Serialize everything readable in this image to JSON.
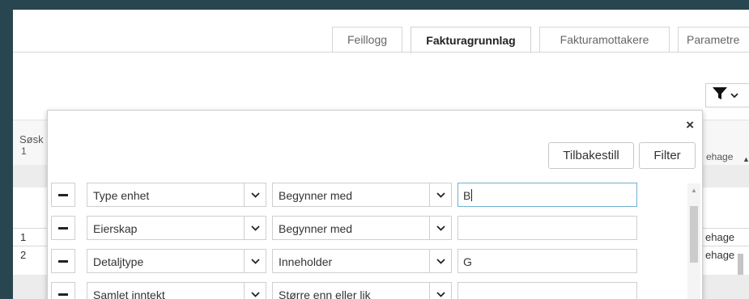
{
  "tabs": [
    {
      "label": "Feillogg",
      "active": false
    },
    {
      "label": "Fakturagrunnlag",
      "active": true
    },
    {
      "label": "Fakturamottakere",
      "active": false
    },
    {
      "label": "Parametre",
      "active": false
    }
  ],
  "grid": {
    "header_label": "Søsk",
    "header_num": "1",
    "right_header": "ehage",
    "rows": [
      {
        "num": "1",
        "right": "ehage"
      },
      {
        "num": "2",
        "right": "ehage"
      }
    ]
  },
  "modal": {
    "close_label": "×",
    "reset_label": "Tilbakestill",
    "filter_label": "Filter",
    "rows": [
      {
        "field": "Type enhet",
        "operator": "Begynner med",
        "value": "B"
      },
      {
        "field": "Eierskap",
        "operator": "Begynner med",
        "value": ""
      },
      {
        "field": "Detaljtype",
        "operator": "Inneholder",
        "value": "G"
      },
      {
        "field": "Samlet inntekt",
        "operator": "Større enn eller lik",
        "value": ""
      }
    ]
  },
  "icons": {
    "filter": "filter-funnel-icon",
    "chevron": "chevron-down-icon",
    "minus": "minus-icon"
  }
}
